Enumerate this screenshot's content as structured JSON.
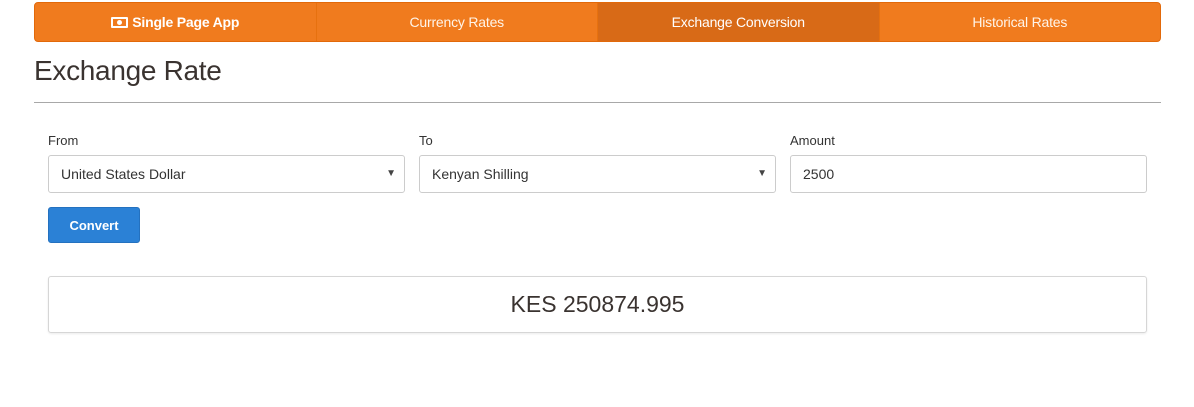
{
  "navbar": {
    "brand": "Single Page App",
    "items": [
      {
        "label": "Currency Rates"
      },
      {
        "label": "Exchange Conversion"
      },
      {
        "label": "Historical Rates"
      }
    ],
    "active": "Exchange Conversion"
  },
  "page": {
    "title": "Exchange Rate"
  },
  "form": {
    "from_label": "From",
    "from_value": "United States Dollar",
    "to_label": "To",
    "to_value": "Kenyan Shilling",
    "amount_label": "Amount",
    "amount_value": "2500",
    "convert_label": "Convert"
  },
  "result": {
    "text": "KES 250874.995"
  },
  "colors": {
    "navbar": "#f07b1e",
    "navbar_active": "#d86a17",
    "button": "#2b81d6"
  },
  "icons": {
    "brand": "money-icon",
    "select_caret": "caret-down-icon"
  }
}
